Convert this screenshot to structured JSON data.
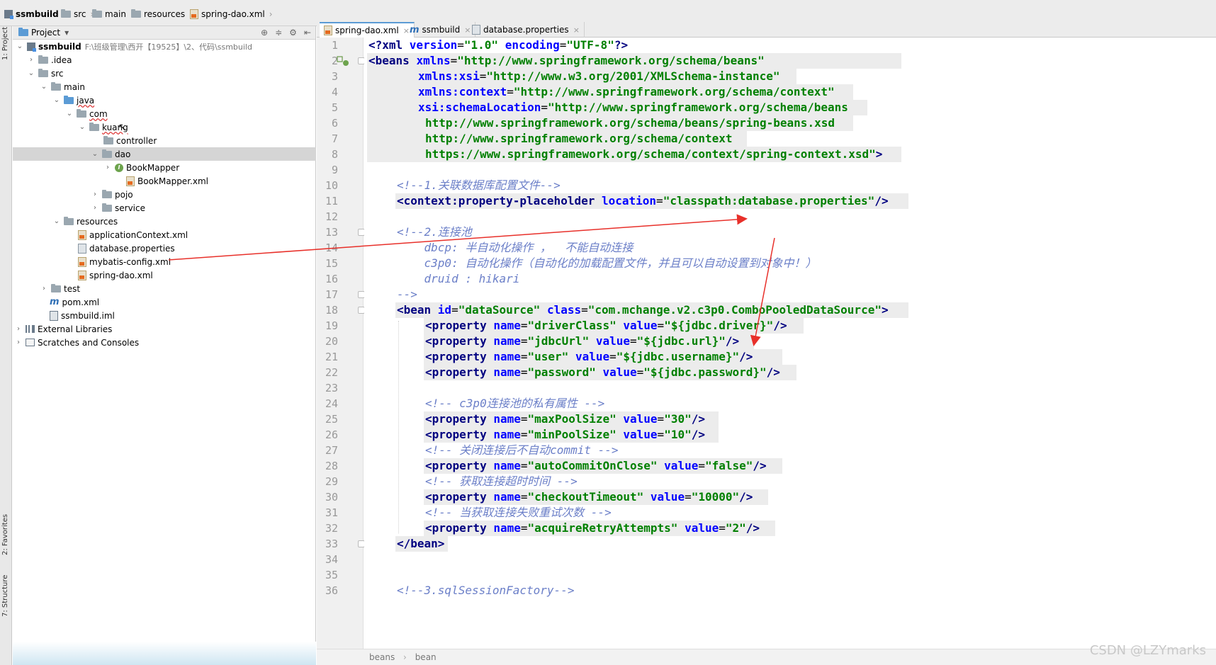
{
  "breadcrumb": {
    "items": [
      {
        "label": "ssmbuild",
        "icon": "module-icon"
      },
      {
        "label": "src",
        "icon": "folder-icon"
      },
      {
        "label": "main",
        "icon": "folder-icon"
      },
      {
        "label": "resources",
        "icon": "folder-icon"
      },
      {
        "label": "spring-dao.xml",
        "icon": "xml-file-icon"
      }
    ]
  },
  "stripe": {
    "project": "1: Project",
    "favorites": "2: Favorites",
    "structure": "7: Structure"
  },
  "project_panel": {
    "title": "Project",
    "dropdown": "▾"
  },
  "tree": {
    "root_name": "ssmbuild",
    "root_path": "F:\\班级管理\\西开【19525】\\2、代码\\ssmbuild",
    "idea": ".idea",
    "src": "src",
    "main": "main",
    "java": "java",
    "com": "com",
    "kuang": "kuang",
    "controller": "controller",
    "dao": "dao",
    "bookmapper": "BookMapper",
    "bookmapper_xml": "BookMapper.xml",
    "pojo": "pojo",
    "service": "service",
    "resources": "resources",
    "appctx": "applicationContext.xml",
    "dbprops": "database.properties",
    "mybatis": "mybatis-config.xml",
    "springdao": "spring-dao.xml",
    "test": "test",
    "pom": "pom.xml",
    "iml": "ssmbuild.iml",
    "extlib": "External Libraries",
    "scratches": "Scratches and Consoles"
  },
  "tabs": [
    {
      "label": "spring-dao.xml",
      "active": true
    },
    {
      "label": "ssmbuild",
      "active": false
    },
    {
      "label": "database.properties",
      "active": false
    }
  ],
  "line_numbers": [
    "1",
    "2",
    "3",
    "4",
    "5",
    "6",
    "7",
    "8",
    "9",
    "10",
    "11",
    "12",
    "13",
    "14",
    "15",
    "16",
    "17",
    "18",
    "19",
    "20",
    "21",
    "22",
    "23",
    "24",
    "25",
    "26",
    "27",
    "28",
    "29",
    "30",
    "31",
    "32",
    "33",
    "34",
    "35",
    "36"
  ],
  "code": {
    "l1": [
      "<?",
      "xml ",
      "version",
      "=",
      "\"1.0\"",
      " ",
      "encoding",
      "=",
      "\"UTF-8\"",
      "?>"
    ],
    "l2_tag": "<beans ",
    "l2_attr": "xmlns",
    "l2_val": "\"http://www.springframework.org/schema/beans\"",
    "l3_attr": "xmlns:xsi",
    "l3_val": "\"http://www.w3.org/2001/XMLSchema-instance\"",
    "l4_attr": "xmlns:context",
    "l4_val": "\"http://www.springframework.org/schema/context\"",
    "l5_attr": "xsi:schemaLocation",
    "l5_val": "\"http://www.springframework.org/schema/beans",
    "l6": "http://www.springframework.org/schema/beans/spring-beans.xsd",
    "l7": "http://www.springframework.org/schema/context",
    "l8": "https://www.springframework.org/schema/context/spring-context.xsd\"",
    "l8_end": ">",
    "l10": "<!--1.关联数据库配置文件-->",
    "l11_tag": "<context:property-placeholder ",
    "l11_attr": "location",
    "l11_val": "\"classpath:database.properties\"",
    "l11_end": "/>",
    "l13": "<!--2.连接池",
    "l14": "    dbcp: 半自动化操作 ，  不能自动连接",
    "l15": "    c3p0: 自动化操作（自动化的加载配置文件，并且可以自动设置到对象中！）",
    "l16": "    druid : hikari",
    "l17": "-->",
    "l18_tag": "<bean ",
    "l18_a1": "id",
    "l18_v1": "\"dataSource\"",
    "l18_a2": "class",
    "l18_v2": "\"com.mchange.v2.c3p0.ComboPooledDataSource\"",
    "l18_end": ">",
    "prop_tag": "<property ",
    "name_attr": "name",
    "value_attr": "value",
    "l19_n": "\"driverClass\"",
    "l19_v": "\"${jdbc.driver}\"",
    "l20_n": "\"jdbcUrl\"",
    "l20_v": "\"${jdbc.url}\"",
    "l21_n": "\"user\"",
    "l21_v": "\"${jdbc.username}\"",
    "l22_n": "\"password\"",
    "l22_v": "\"${jdbc.password}\"",
    "selfclose": "/>",
    "l24": "<!-- c3p0连接池的私有属性 -->",
    "l25_n": "\"maxPoolSize\"",
    "l25_v": "\"30\"",
    "l26_n": "\"minPoolSize\"",
    "l26_v": "\"10\"",
    "l27": "<!-- 关闭连接后不自动commit -->",
    "l28_n": "\"autoCommitOnClose\"",
    "l28_v": "\"false\"",
    "l29": "<!-- 获取连接超时时间 -->",
    "l30_n": "\"checkoutTimeout\"",
    "l30_v": "\"10000\"",
    "l31": "<!-- 当获取连接失败重试次数 -->",
    "l32_n": "\"acquireRetryAttempts\"",
    "l32_v": "\"2\"",
    "l33": "</bean>",
    "l36": "<!--3.sqlSessionFactory-->"
  },
  "statusbar": {
    "crumb1": "beans",
    "crumb2": "bean"
  },
  "watermark": "CSDN @LZYmarks",
  "colors": {
    "tag": "#000080",
    "attr": "#0000ff",
    "string": "#008000",
    "comment": "#6b7fc8",
    "annotation_arrow": "#e8302a"
  }
}
